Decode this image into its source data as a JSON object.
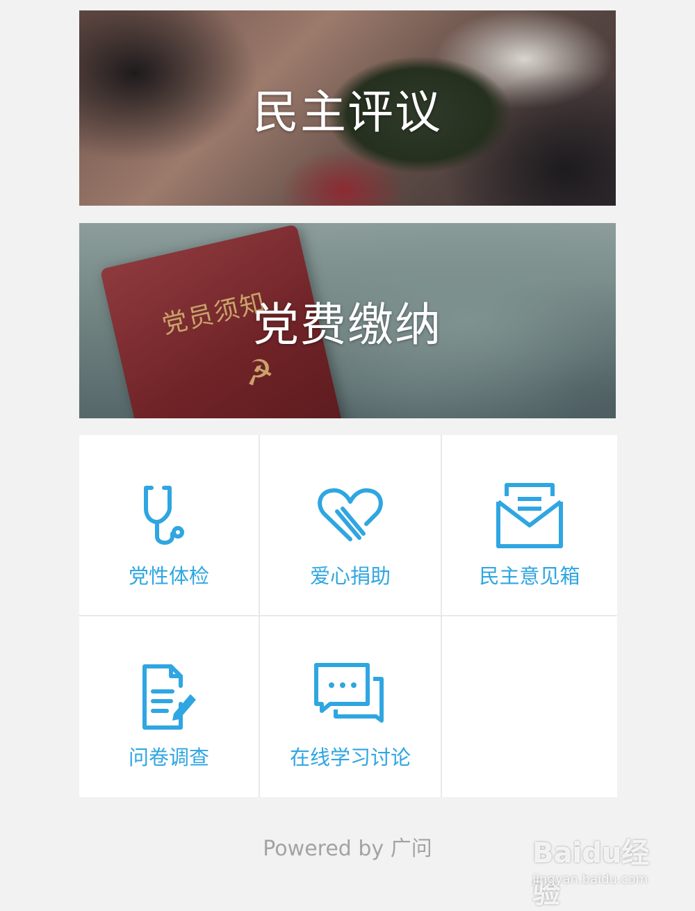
{
  "banners": [
    {
      "title": "民主评议"
    },
    {
      "title": "党费缴纳",
      "photo_text": "党员须知"
    }
  ],
  "grid": {
    "items": [
      {
        "label": "党性体检",
        "icon": "stethoscope-icon"
      },
      {
        "label": "爱心捐助",
        "icon": "heart-icon"
      },
      {
        "label": "民主意见箱",
        "icon": "envelope-icon"
      },
      {
        "label": "问卷调查",
        "icon": "document-edit-icon"
      },
      {
        "label": "在线学习讨论",
        "icon": "chat-bubbles-icon"
      }
    ]
  },
  "footer": {
    "text": "Powered by 广问"
  },
  "watermark": {
    "logo": "Baidu经验",
    "url": "jingyan.baidu.com"
  },
  "colors": {
    "accent": "#2fa6e1",
    "background": "#f2f2f2",
    "footer_text": "#a3a3a3"
  }
}
